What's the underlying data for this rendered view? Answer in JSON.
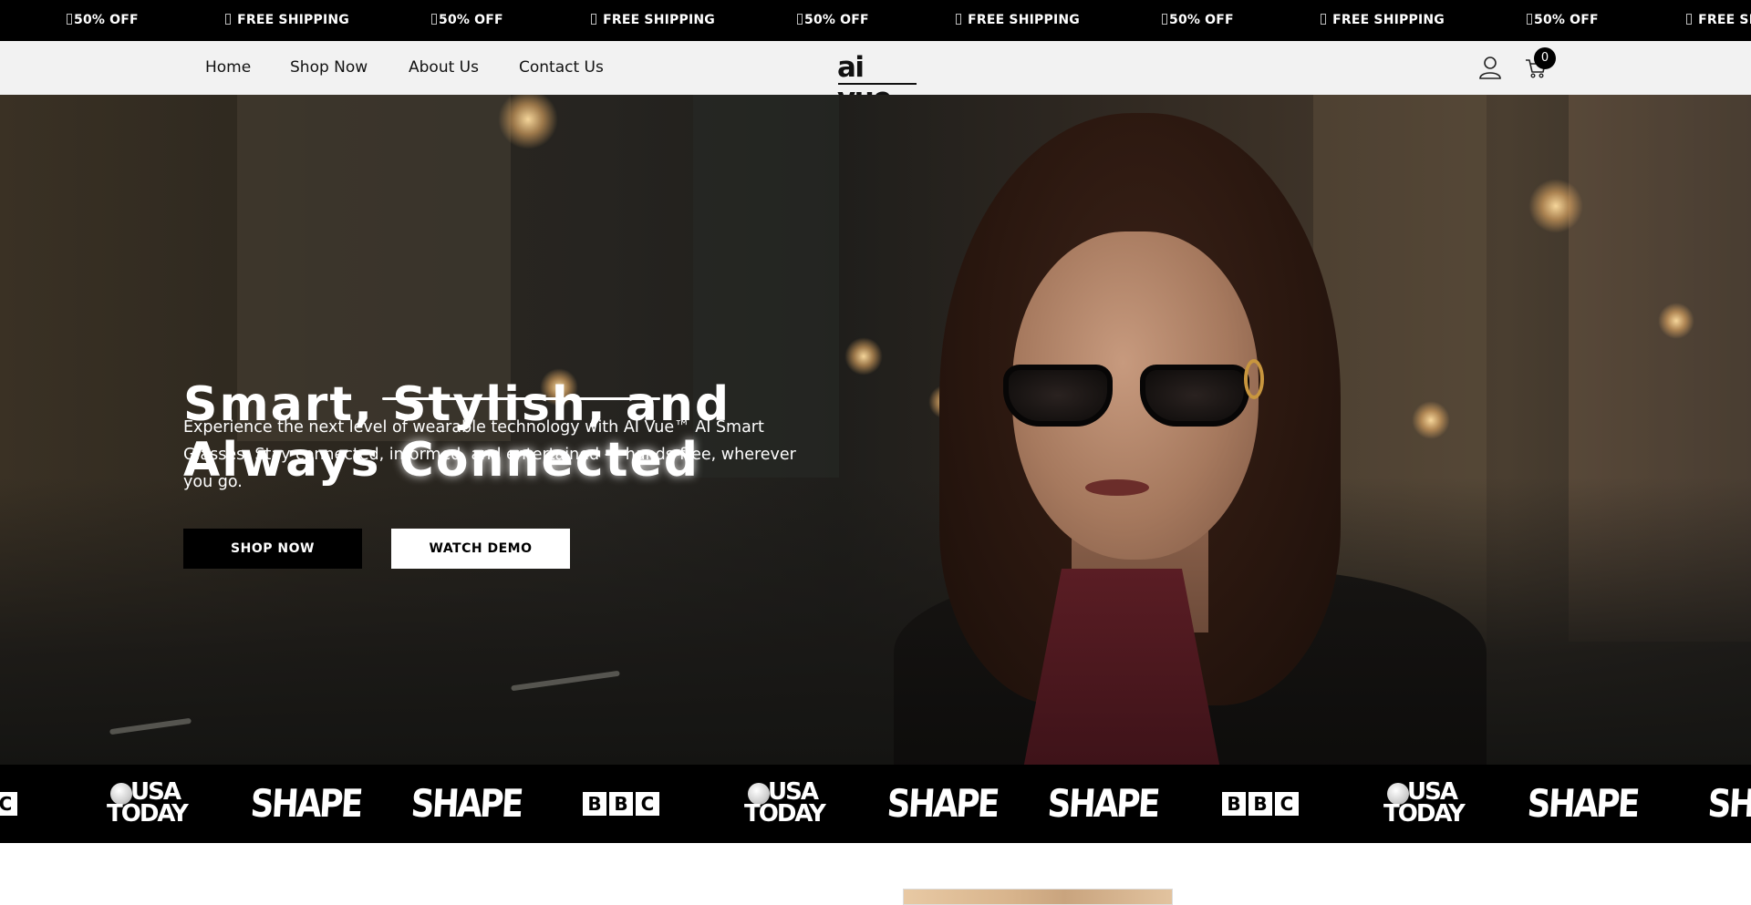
{
  "announcement": {
    "items": [
      "50% OFF",
      "FREE SHIPPING",
      "50% OFF",
      "FREE SHIPPING",
      "50% OFF",
      "FREE SHIPPING",
      "50% OFF",
      "FREE SHIPPING",
      "50% OFF",
      "FREE SHI"
    ]
  },
  "header": {
    "nav": [
      "Home",
      "Shop Now",
      "About Us",
      "Contact Us"
    ],
    "logo": "ai vue",
    "cart_count": "0",
    "icons": {
      "account": "user-icon",
      "cart": "cart-icon"
    }
  },
  "hero": {
    "title_line1": "Smart, Stylish, and",
    "title_line2_prefix": "Always ",
    "title_line2_highlight": "Connected",
    "subtitle": "Experience the next level of wearable technology with AI Vue™ AI Smart Glasses. Stay connected, informed, and entertained — hands-free, wherever you go.",
    "primary_button": "SHOP NOW",
    "secondary_button": "WATCH DEMO"
  },
  "press": {
    "logos": [
      "BBC",
      "USA TODAY",
      "SHAPE",
      "SHAPE",
      "BBC",
      "USA TODAY",
      "SHAPE",
      "SHAPE",
      "BBC",
      "USA TODAY",
      "SHAPE",
      "SHAPE"
    ]
  },
  "colors": {
    "announcement_bg": "#000000",
    "header_bg": "#f2f2f2",
    "primary_button_bg": "#000000",
    "secondary_button_bg": "#ffffff",
    "press_bg": "#000000"
  }
}
